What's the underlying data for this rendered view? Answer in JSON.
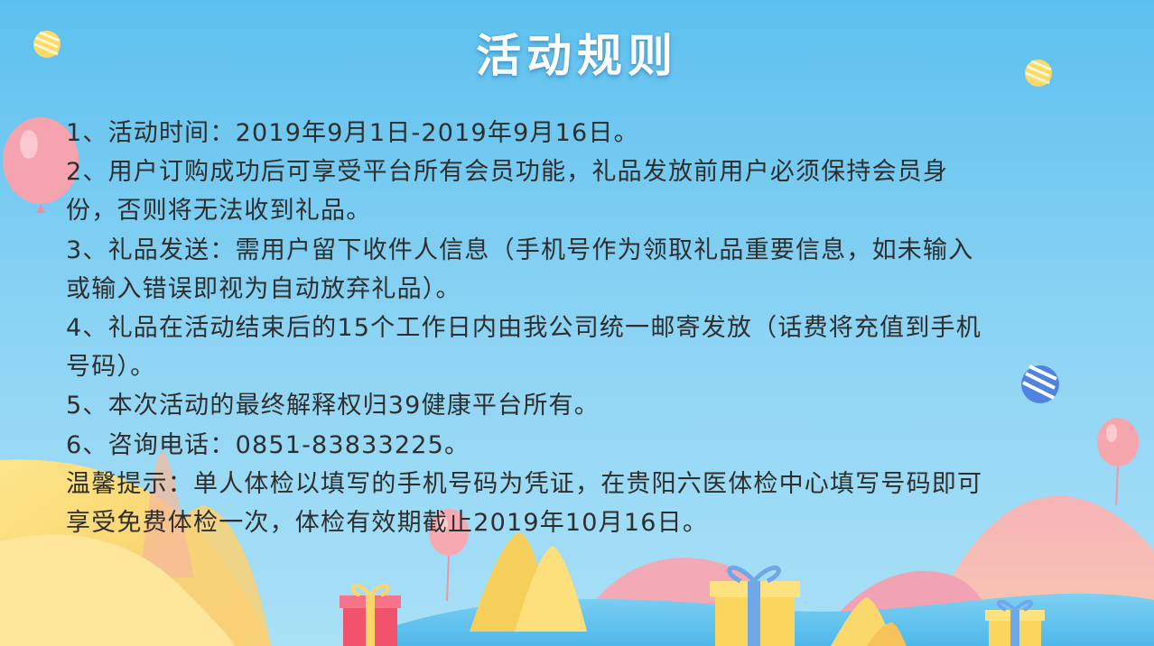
{
  "title": "活动规则",
  "rules": [
    "1、活动时间：2019年9月1日-2019年9月16日。",
    "2、用户订购成功后可享受平台所有会员功能，礼品发放前用户必须保持会员身",
    "份，否则将无法收到礼品。",
    "3、礼品发送：需用户留下收件人信息（手机号作为领取礼品重要信息，如未输入",
    "或输入错误即视为自动放弃礼品）。",
    "4、礼品在活动结束后的15个工作日内由我公司统一邮寄发放（话费将充值到手机",
    "号码）。",
    "5、本次活动的最终解释权归39健康平台所有。",
    "6、咨询电话：0851-83833225。",
    "温馨提示：单人体检以填写的手机号码为凭证，在贵阳六医体检中心填写号码即可",
    "享受免费体检一次，体检有效期截止2019年10月16日。"
  ],
  "colors": {
    "sky": "#5ec3ef",
    "title": "#ffffff",
    "text": "#2e2e2e"
  },
  "decorations": [
    "balloon",
    "gift-box",
    "candy-ball",
    "hills"
  ]
}
